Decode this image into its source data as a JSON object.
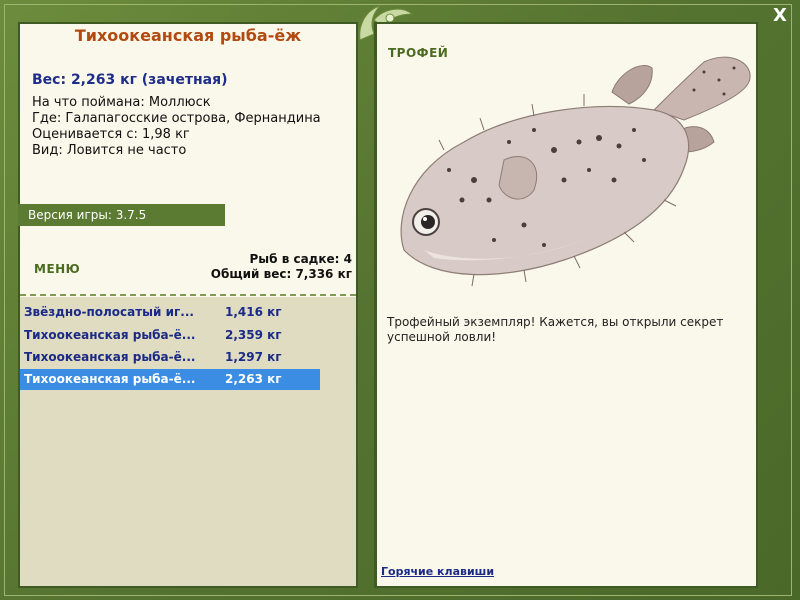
{
  "window": {
    "close_label": "X"
  },
  "fish": {
    "title": "Тихоокеанская рыба-ёж",
    "weight_line": "Вес: 2,263 кг (зачетная)",
    "info": [
      "На что поймана: Моллюск",
      "Где: Галапагосские острова, Фернандина",
      "Оценивается с: 1,98 кг",
      "Вид: Ловится не часто"
    ]
  },
  "version": "Версия игры: 3.7.5",
  "menu_label": "МЕНЮ",
  "cage": {
    "count_line": "Рыб в садке: 4",
    "total_line": "Общий вес: 7,336 кг"
  },
  "catch_list": [
    {
      "name": "Звёздно-полосатый иг...",
      "weight": "1,416 кг",
      "selected": false
    },
    {
      "name": "Тихоокеанская рыба-ё...",
      "weight": "2,359 кг",
      "selected": false
    },
    {
      "name": "Тихоокеанская рыба-ё...",
      "weight": "1,297 кг",
      "selected": false
    },
    {
      "name": "Тихоокеанская рыба-ё...",
      "weight": "2,263 кг",
      "selected": true
    }
  ],
  "trophy": {
    "label": "ТРОФЕЙ",
    "text": "Трофейный экземпляр! Кажется, вы открыли секрет успешной ловли!"
  },
  "hotkeys_label": "Горячие клавиши",
  "colors": {
    "frame": "#5b7a32",
    "panel_bg": "#faf8ea",
    "title": "#b24a11",
    "link": "#1b2a87",
    "selected_row": "#3b8de3"
  }
}
